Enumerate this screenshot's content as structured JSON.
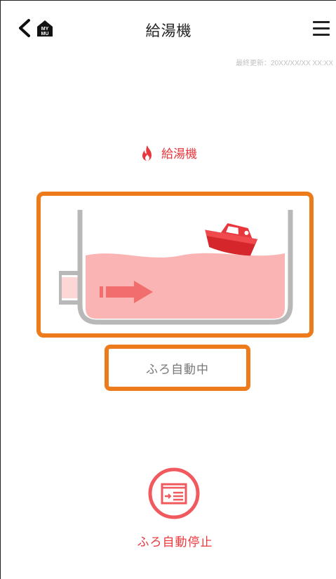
{
  "header": {
    "title": "給湯機",
    "back_icon": "chevron-left-icon",
    "logo_icon": "mymu-house-icon",
    "logo_text_top": "MY",
    "logo_text_bottom": "MU",
    "menu_icon": "hamburger-menu-icon"
  },
  "last_updated": "最終更新：20XX/XX/XX XX:XX",
  "device": {
    "label": "給湯機",
    "icon": "flame-icon"
  },
  "illustration": {
    "state": "bath-filling",
    "icons": [
      "bathtub-icon",
      "boat-icon",
      "inflow-arrow-icon"
    ]
  },
  "status": {
    "text": "ふろ自動中"
  },
  "action": {
    "label": "ふろ自動停止",
    "icon": "bath-stop-icon"
  },
  "colors": {
    "accent_red": "#e8383d",
    "highlight_orange": "#ee7b1b",
    "water_pink": "#fbb4b4",
    "tub_gray": "#b8b8b8"
  }
}
